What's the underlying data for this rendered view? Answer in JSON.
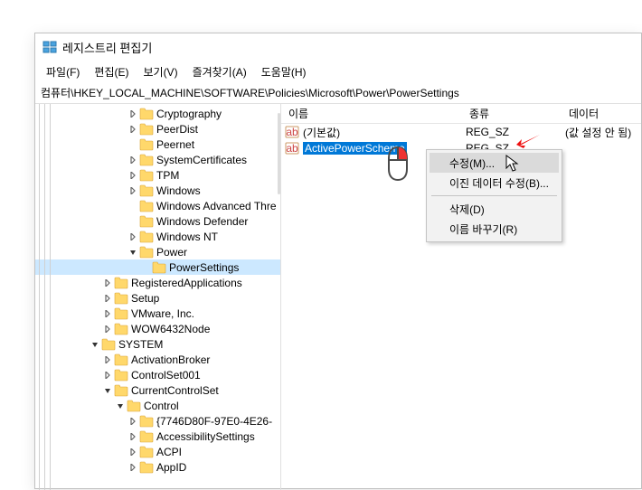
{
  "title": "레지스트리 편집기",
  "menus": {
    "file": "파일(F)",
    "edit": "편집(E)",
    "view": "보기(V)",
    "favorites": "즐겨찾기(A)",
    "help": "도움말(H)"
  },
  "address": "컴퓨터\\HKEY_LOCAL_MACHINE\\SOFTWARE\\Policies\\Microsoft\\Power\\PowerSettings",
  "tree": [
    {
      "indent": 7,
      "exp": ">",
      "label": "Cryptography"
    },
    {
      "indent": 7,
      "exp": ">",
      "label": "PeerDist"
    },
    {
      "indent": 7,
      "exp": "",
      "label": "Peernet"
    },
    {
      "indent": 7,
      "exp": ">",
      "label": "SystemCertificates"
    },
    {
      "indent": 7,
      "exp": ">",
      "label": "TPM"
    },
    {
      "indent": 7,
      "exp": ">",
      "label": "Windows"
    },
    {
      "indent": 7,
      "exp": "",
      "label": "Windows Advanced Thre"
    },
    {
      "indent": 7,
      "exp": "",
      "label": "Windows Defender"
    },
    {
      "indent": 7,
      "exp": ">",
      "label": "Windows NT"
    },
    {
      "indent": 7,
      "exp": "v",
      "label": "Power"
    },
    {
      "indent": 8,
      "exp": "",
      "label": "PowerSettings",
      "selected": true
    },
    {
      "indent": 5,
      "exp": ">",
      "label": "RegisteredApplications"
    },
    {
      "indent": 5,
      "exp": ">",
      "label": "Setup"
    },
    {
      "indent": 5,
      "exp": ">",
      "label": "VMware, Inc."
    },
    {
      "indent": 5,
      "exp": ">",
      "label": "WOW6432Node"
    },
    {
      "indent": 4,
      "exp": "v",
      "label": "SYSTEM"
    },
    {
      "indent": 5,
      "exp": ">",
      "label": "ActivationBroker"
    },
    {
      "indent": 5,
      "exp": ">",
      "label": "ControlSet001"
    },
    {
      "indent": 5,
      "exp": "v",
      "label": "CurrentControlSet"
    },
    {
      "indent": 6,
      "exp": "v",
      "label": "Control"
    },
    {
      "indent": 7,
      "exp": ">",
      "label": "{7746D80F-97E0-4E26-"
    },
    {
      "indent": 7,
      "exp": ">",
      "label": "AccessibilitySettings"
    },
    {
      "indent": 7,
      "exp": ">",
      "label": "ACPI"
    },
    {
      "indent": 7,
      "exp": ">",
      "label": "AppID"
    }
  ],
  "list_header": {
    "name": "이름",
    "type": "종류",
    "data": "데이터"
  },
  "list_rows": [
    {
      "name": "(기본값)",
      "type": "REG_SZ",
      "data": "(값 설정 안 됨)",
      "selected": false
    },
    {
      "name": "ActivePowerScheme",
      "type": "REG_SZ",
      "data": "",
      "selected": true
    }
  ],
  "context_menu": {
    "modify": "수정(M)...",
    "modify_binary": "이진 데이터 수정(B)...",
    "delete": "삭제(D)",
    "rename": "이름 바꾸기(R)"
  }
}
